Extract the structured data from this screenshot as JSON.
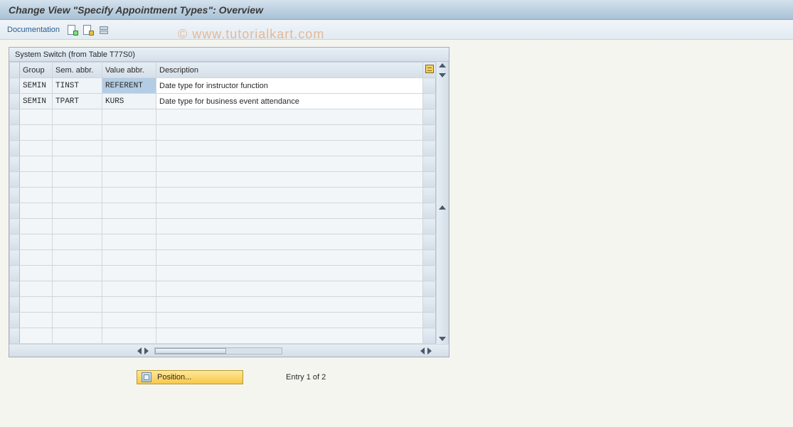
{
  "title": "Change View \"Specify Appointment Types\": Overview",
  "toolbar": {
    "documentation_label": "Documentation"
  },
  "watermark": "© www.tutorialkart.com",
  "panel": {
    "title": "System Switch (from Table T77S0)",
    "columns": {
      "group": "Group",
      "sem": "Sem. abbr.",
      "val": "Value abbr.",
      "desc": "Description"
    },
    "rows": [
      {
        "group": "SEMIN",
        "sem": "TINST",
        "val": "REFERENT",
        "desc": "Date type for instructor function",
        "val_selected": true
      },
      {
        "group": "SEMIN",
        "sem": "TPART",
        "val": "KURS",
        "desc": "Date type for business event attendance",
        "val_selected": false
      }
    ]
  },
  "footer": {
    "position_label": "Position...",
    "entry_info": "Entry 1 of 2"
  }
}
